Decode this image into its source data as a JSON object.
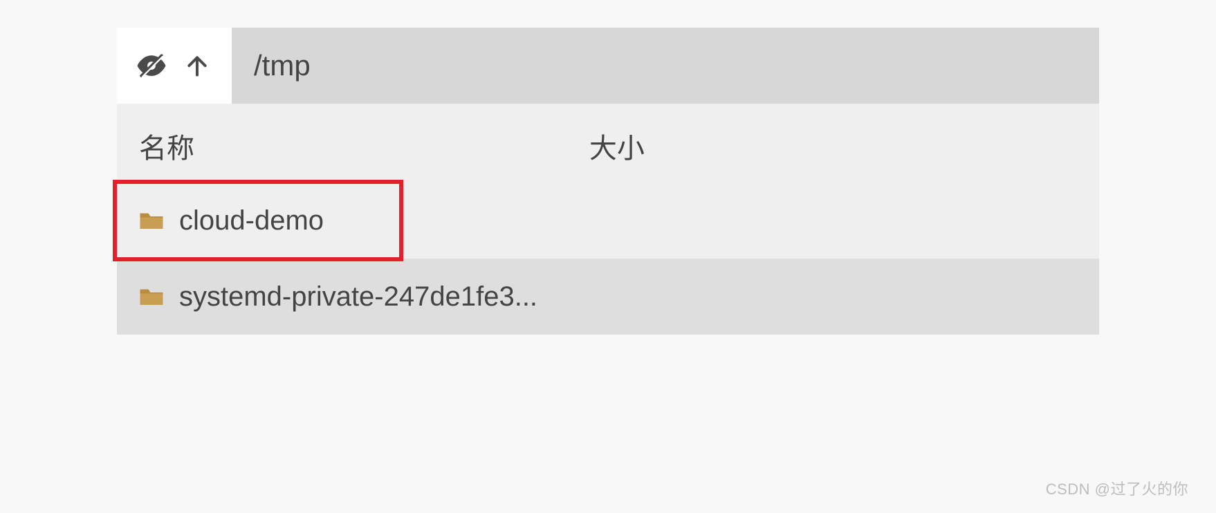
{
  "toolbar": {
    "path": "/tmp"
  },
  "headers": {
    "name": "名称",
    "size": "大小"
  },
  "files": [
    {
      "name": "cloud-demo",
      "highlighted": true
    },
    {
      "name": "systemd-private-247de1fe3...",
      "highlighted": false
    }
  ],
  "watermark": "CSDN @过了火的你",
  "colors": {
    "folder": "#b98c3e",
    "highlight_border": "#e4202c"
  }
}
